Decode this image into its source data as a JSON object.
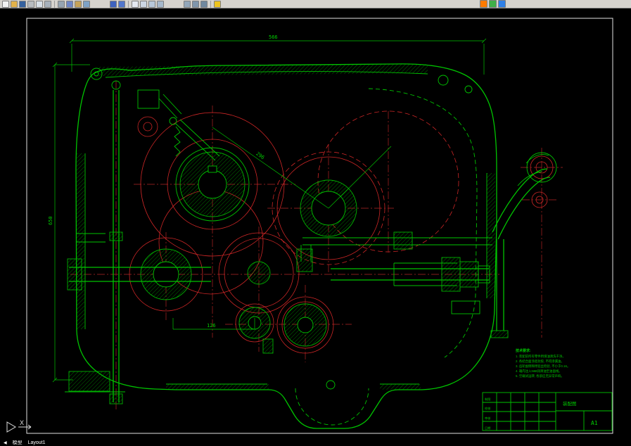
{
  "toolbar": {
    "icons": [
      {
        "name": "qnew",
        "color": "#f2f2f2"
      },
      {
        "name": "open",
        "color": "#e2b24a"
      },
      {
        "name": "save",
        "color": "#35619e"
      },
      {
        "name": "plot",
        "color": "#b8bcc0"
      },
      {
        "name": "plot-preview",
        "color": "#d8e0e8"
      },
      {
        "name": "publish",
        "color": "#a8b2bc"
      },
      {
        "sep": true
      },
      {
        "name": "cut",
        "color": "#96a4b2"
      },
      {
        "name": "copy",
        "color": "#6e86c6"
      },
      {
        "name": "paste",
        "color": "#c6a258"
      },
      {
        "name": "match-properties",
        "color": "#7ea2c6"
      },
      {
        "gap": true
      },
      {
        "name": "undo",
        "color": "#3e62be"
      },
      {
        "name": "redo",
        "color": "#5276cc"
      },
      {
        "sep": true
      },
      {
        "name": "pan-realtime",
        "color": "#e4e8f0"
      },
      {
        "name": "zoom-realtime",
        "color": "#ccd6e4"
      },
      {
        "name": "zoom-window",
        "color": "#b8c8da"
      },
      {
        "name": "zoom-previous",
        "color": "#a6b8cc"
      },
      {
        "gap": true
      },
      {
        "name": "properties",
        "color": "#92a6ba"
      },
      {
        "name": "designcenter",
        "color": "#8096ac"
      },
      {
        "name": "tool-palettes",
        "color": "#70889e"
      },
      {
        "sep": true
      },
      {
        "name": "help",
        "color": "#eec41e"
      },
      {
        "gap": true
      }
    ],
    "overlay_icons": [
      {
        "name": "indicator-orange",
        "color": "#ff7a00"
      },
      {
        "name": "indicator-green",
        "color": "#3fae49"
      },
      {
        "name": "indicator-blue",
        "color": "#2f80e8"
      }
    ]
  },
  "drawing": {
    "colors": {
      "entity_green": "#00c300",
      "construction_red": "#cc2626",
      "frame_white": "#e2e2e2"
    },
    "dims": {
      "top_width": "566",
      "left_height": "650",
      "bottom_center": "126",
      "diagonal": "296"
    },
    "notes": {
      "title": "技术要求:",
      "lines": [
        "1. 装配前所有零件用煤油清洗干净。",
        "2. 各结合面涂密封胶, 不得渗漏油。",
        "3. 齿轮副侧隙用铅丝检验, 不小于0.16。",
        "4. 箱内注入N68润滑油至油面线。",
        "5. 空载试运转, 各部应无异常声响。"
      ]
    },
    "title_block": {
      "sheet_size": "A1",
      "title": "装配图",
      "cells": [
        "制图",
        "校核",
        "审核",
        "日期"
      ]
    },
    "ucs_label": "X"
  },
  "statusbar": {
    "scroll_glyph": "◀",
    "tabs": [
      "模型",
      "Layout1"
    ]
  }
}
